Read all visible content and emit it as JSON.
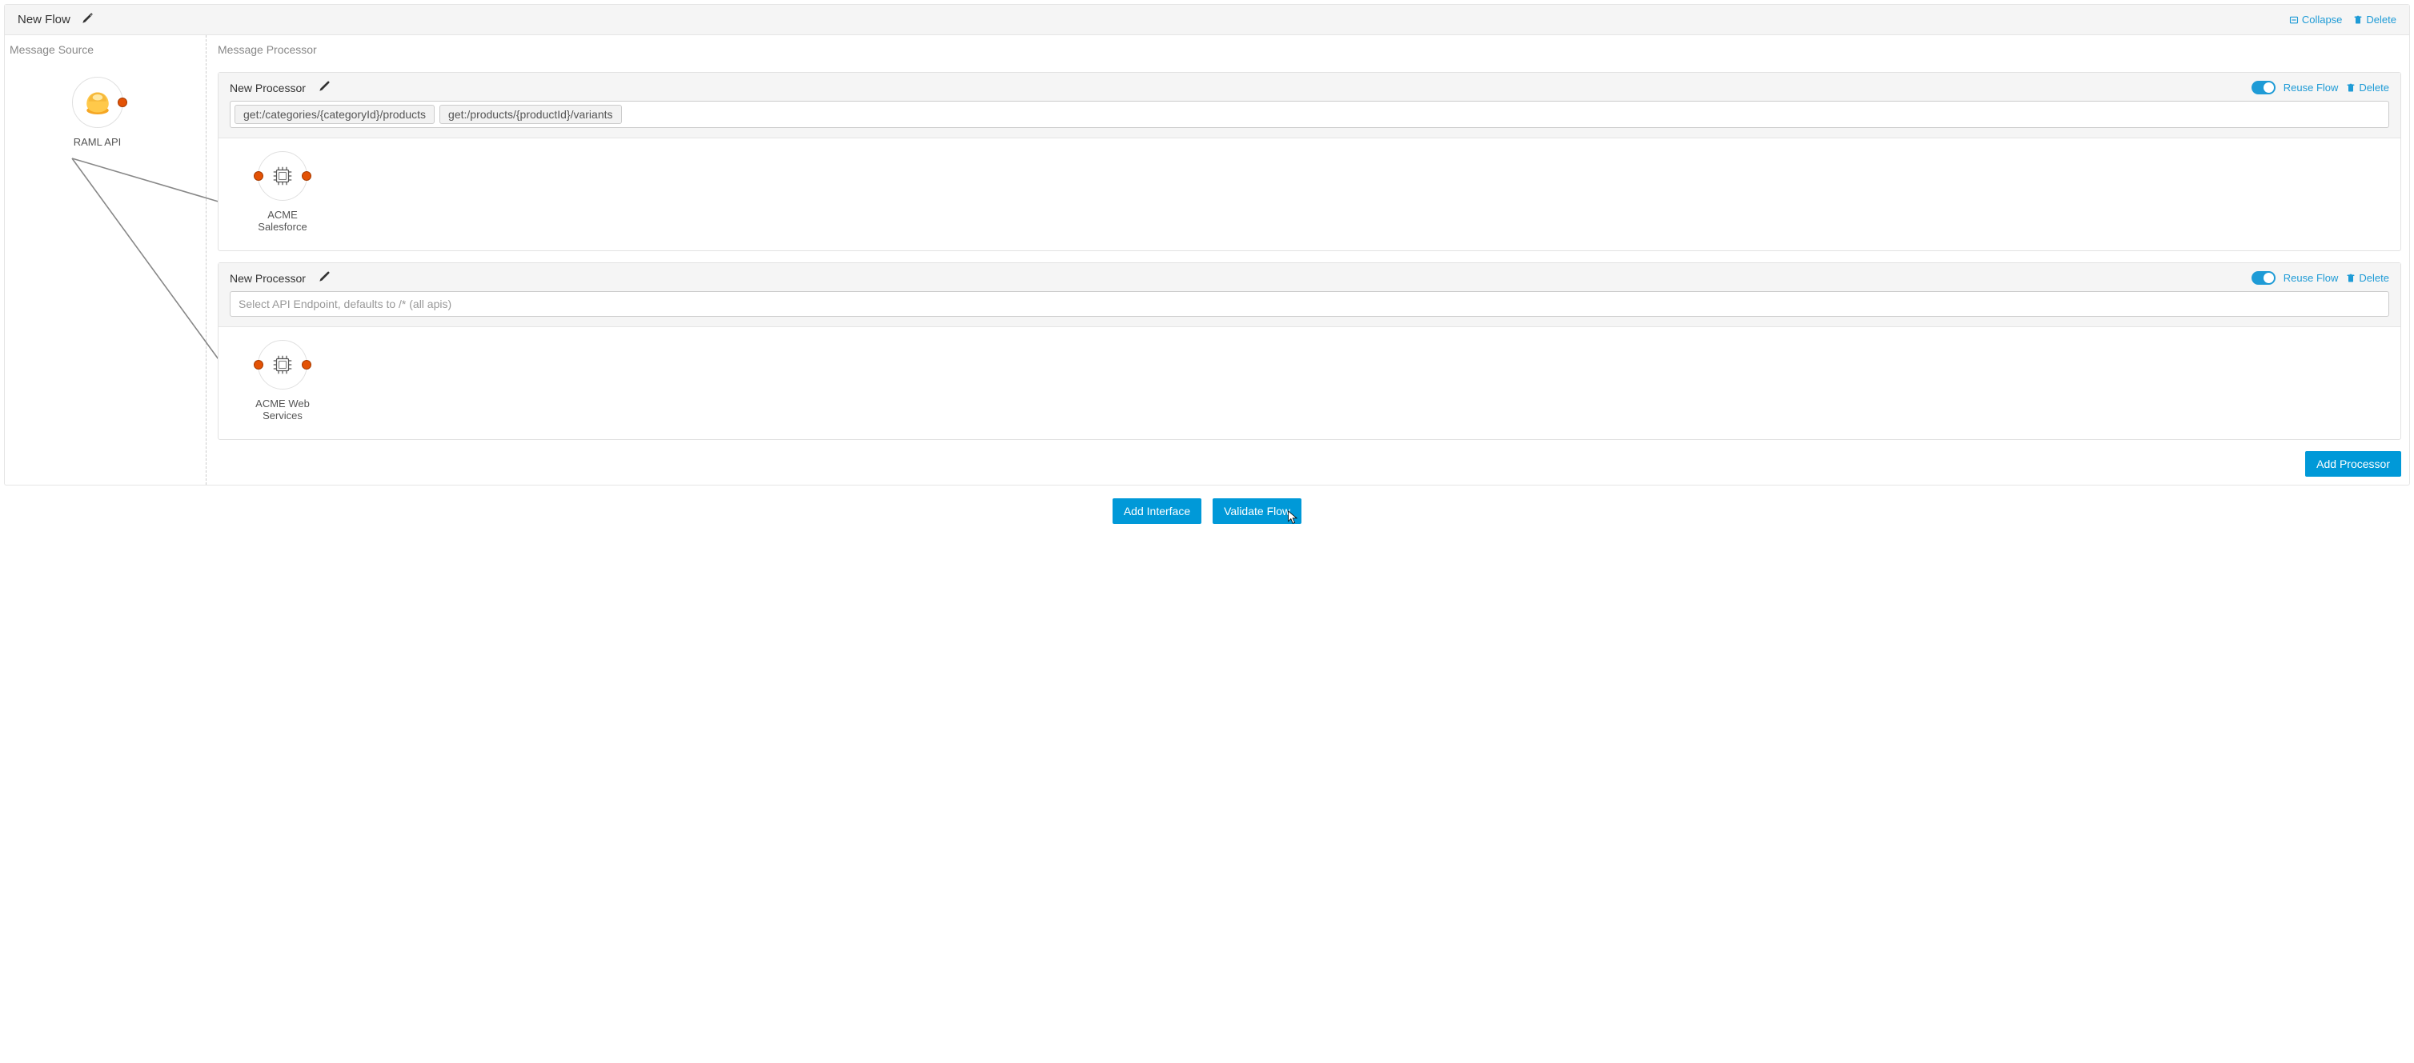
{
  "flow_title": "New Flow",
  "top_actions": {
    "collapse": "Collapse",
    "delete": "Delete"
  },
  "source_section_title": "Message Source",
  "processor_section_title": "Message Processor",
  "source_node": {
    "label": "RAML API"
  },
  "processors": [
    {
      "title": "New Processor",
      "reuse_label": "Reuse Flow",
      "delete_label": "Delete",
      "endpoints": [
        "get:/categories/{categoryId}/products",
        "get:/products/{productId}/variants"
      ],
      "node_label_line1": "ACME",
      "node_label_line2": "Salesforce"
    },
    {
      "title": "New Processor",
      "reuse_label": "Reuse Flow",
      "delete_label": "Delete",
      "endpoint_placeholder": "Select API Endpoint, defaults to /* (all apis)",
      "node_label_line1": "ACME Web",
      "node_label_line2": "Services"
    }
  ],
  "add_processor_label": "Add Processor",
  "footer": {
    "add_interface": "Add Interface",
    "validate_flow": "Validate Flow"
  }
}
